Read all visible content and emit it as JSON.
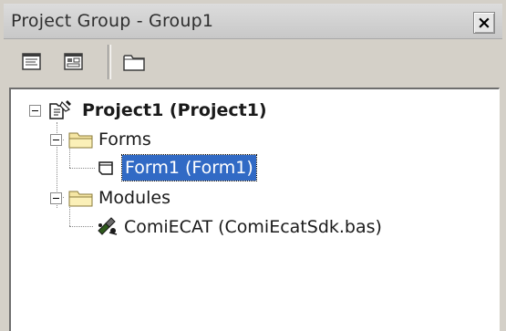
{
  "window": {
    "title": "Project Group - Group1",
    "close_label": "×"
  },
  "toolbar": {
    "buttons": [
      {
        "icon": "view-code-icon"
      },
      {
        "icon": "view-object-icon"
      },
      {
        "icon": "toggle-folders-icon"
      }
    ]
  },
  "tree": {
    "project": {
      "label": "Project1 (Project1)",
      "icon": "project-icon"
    },
    "folders": [
      {
        "label": "Forms",
        "icon": "folder-icon",
        "items": [
          {
            "label": "Form1 (Form1)",
            "icon": "form-icon",
            "selected": true
          }
        ]
      },
      {
        "label": "Modules",
        "icon": "folder-icon",
        "items": [
          {
            "label": "ComiECAT (ComiEcatSdk.bas)",
            "icon": "module-icon",
            "selected": false
          }
        ]
      }
    ]
  },
  "colors": {
    "selection": "#316ac5",
    "panel_bg": "#ffffff",
    "chrome_bg": "#d4d0c8"
  }
}
